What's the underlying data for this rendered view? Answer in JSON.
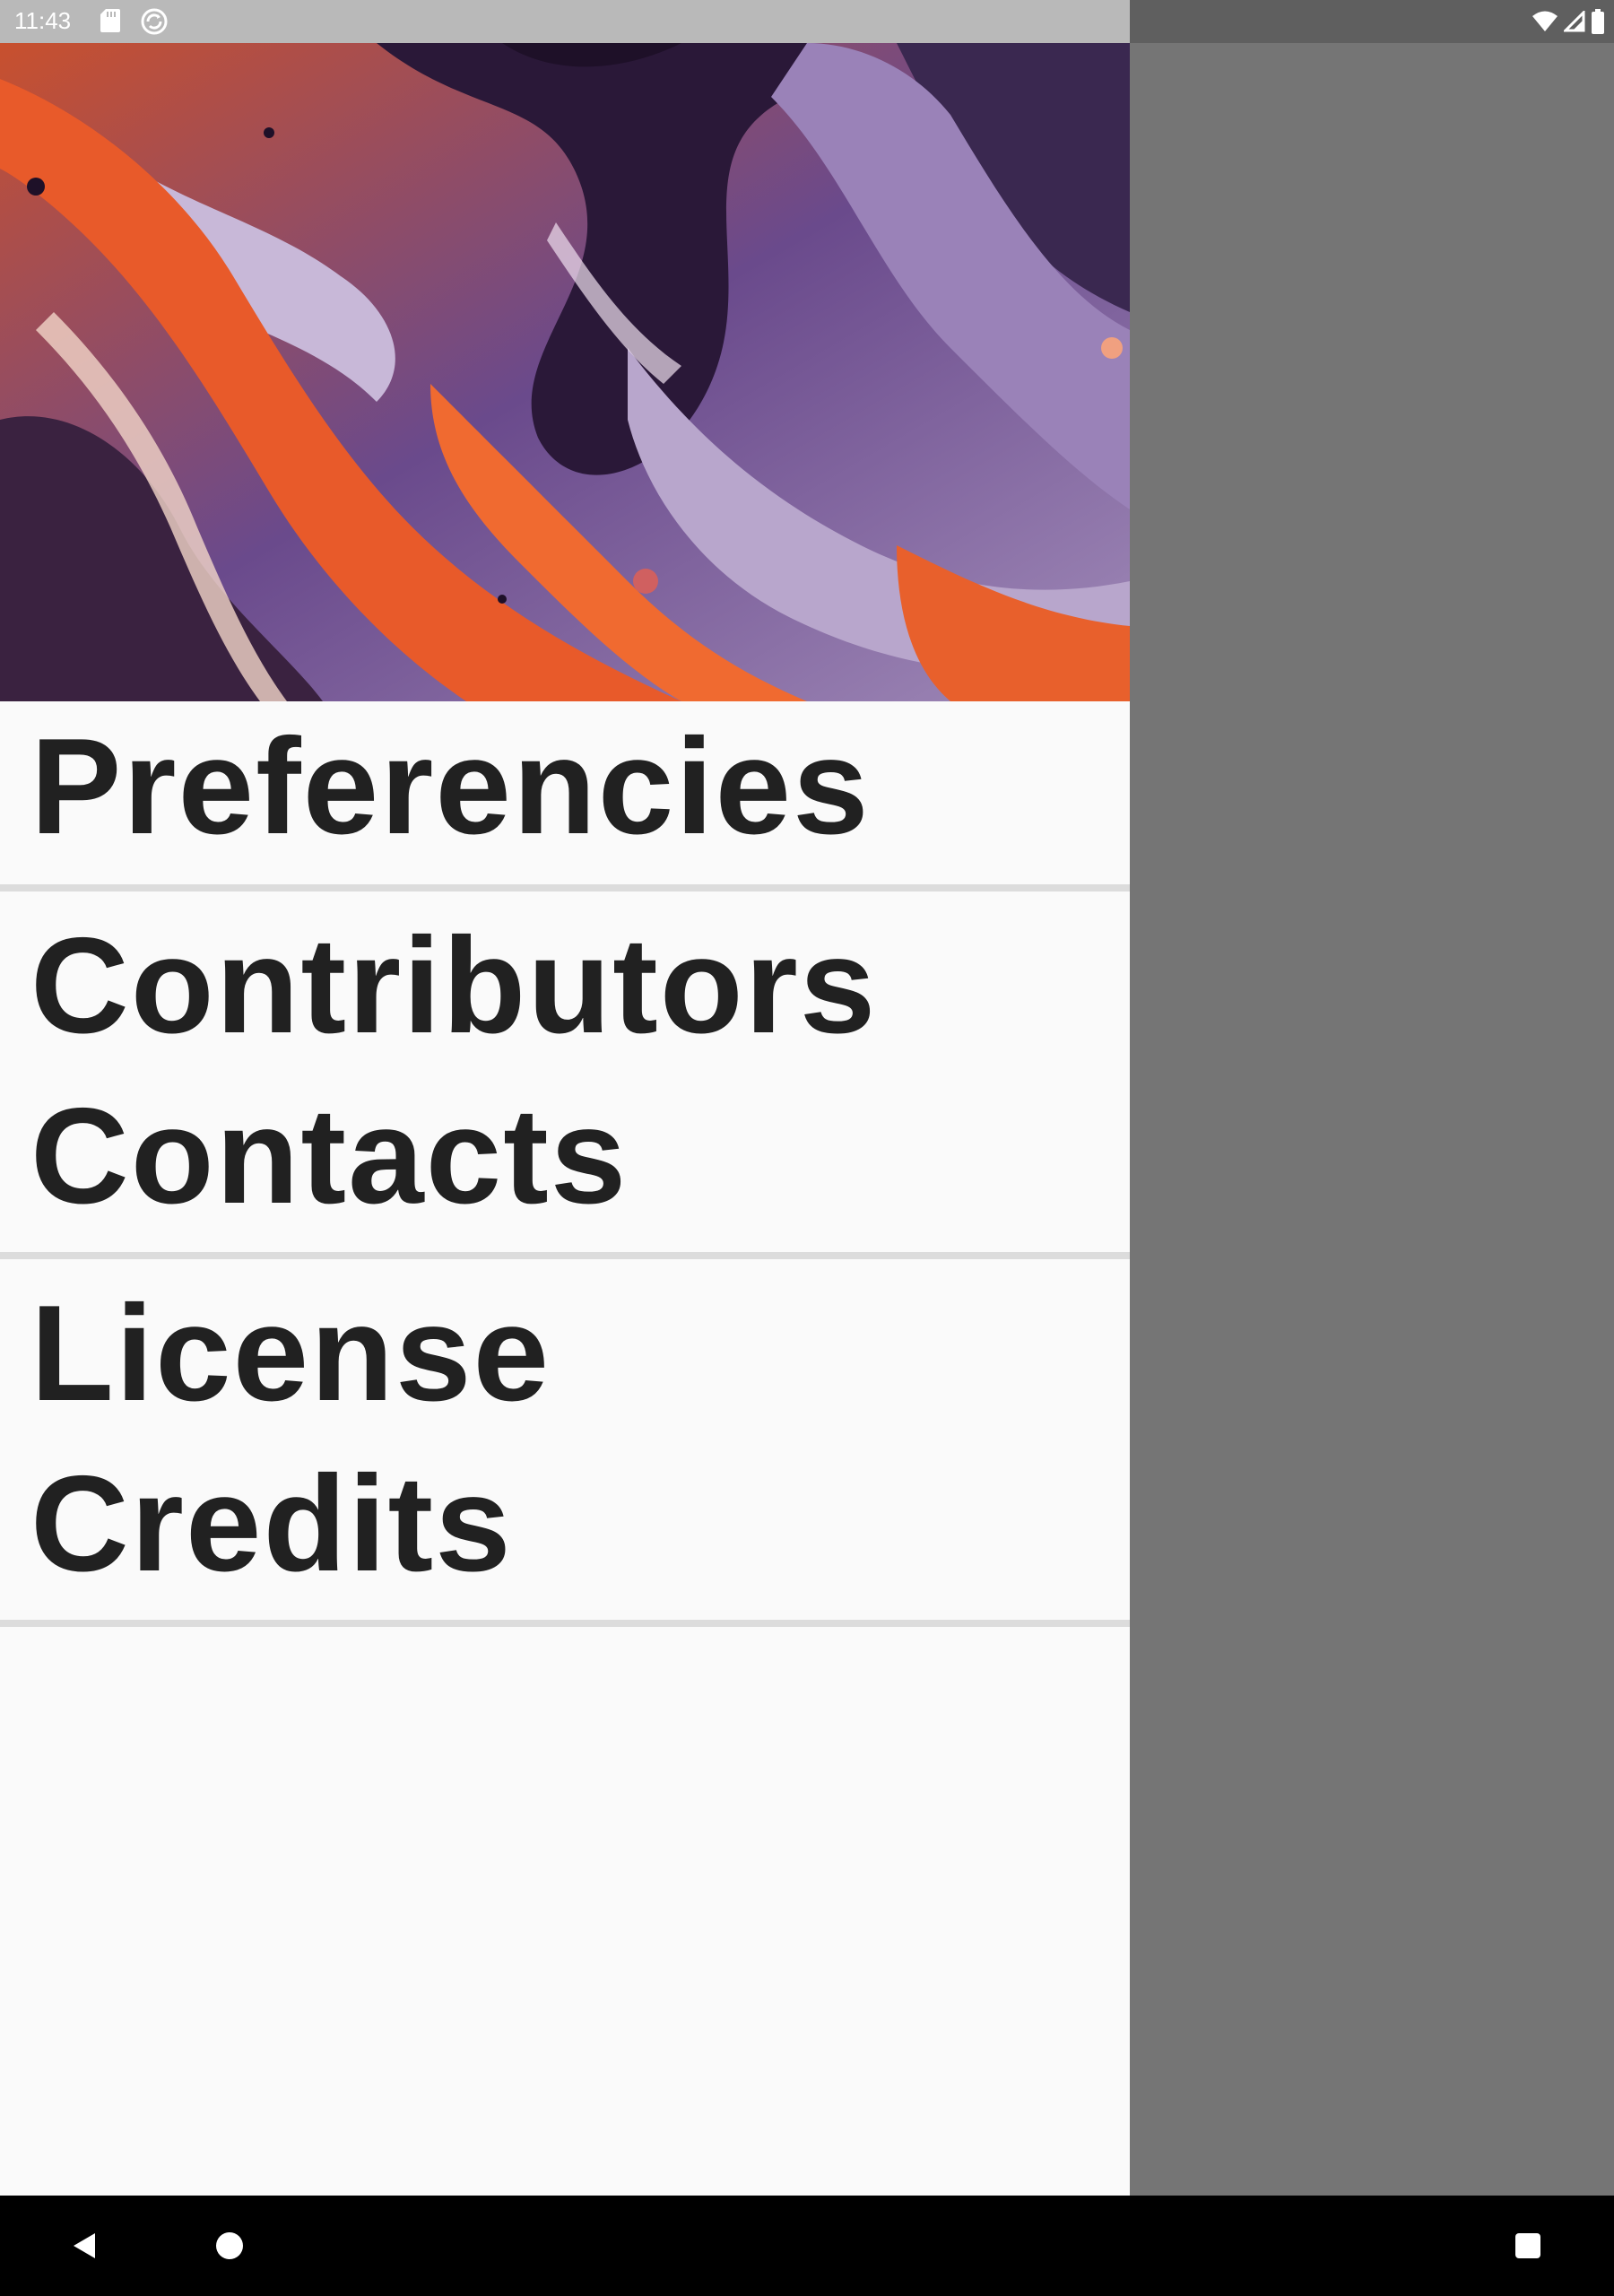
{
  "status_bar": {
    "time": "11:43",
    "icons": [
      "sd-card-icon",
      "sync-icon",
      "wifi-icon",
      "signal-icon",
      "battery-icon"
    ]
  },
  "drawer": {
    "header_image": "abstract-fluid-art",
    "groups": [
      {
        "items": [
          {
            "label": "Preferencies"
          }
        ]
      },
      {
        "items": [
          {
            "label": "Contributors"
          },
          {
            "label": "Contacts"
          }
        ]
      },
      {
        "items": [
          {
            "label": "License"
          },
          {
            "label": "Credits"
          }
        ]
      }
    ]
  },
  "nav_bar": {
    "buttons": [
      "back-icon",
      "home-icon",
      "recents-icon"
    ]
  },
  "colors": {
    "drawer_background": "#fafafa",
    "scrim": "#757575",
    "divider": "#dcdcdc",
    "text": "#212121"
  }
}
